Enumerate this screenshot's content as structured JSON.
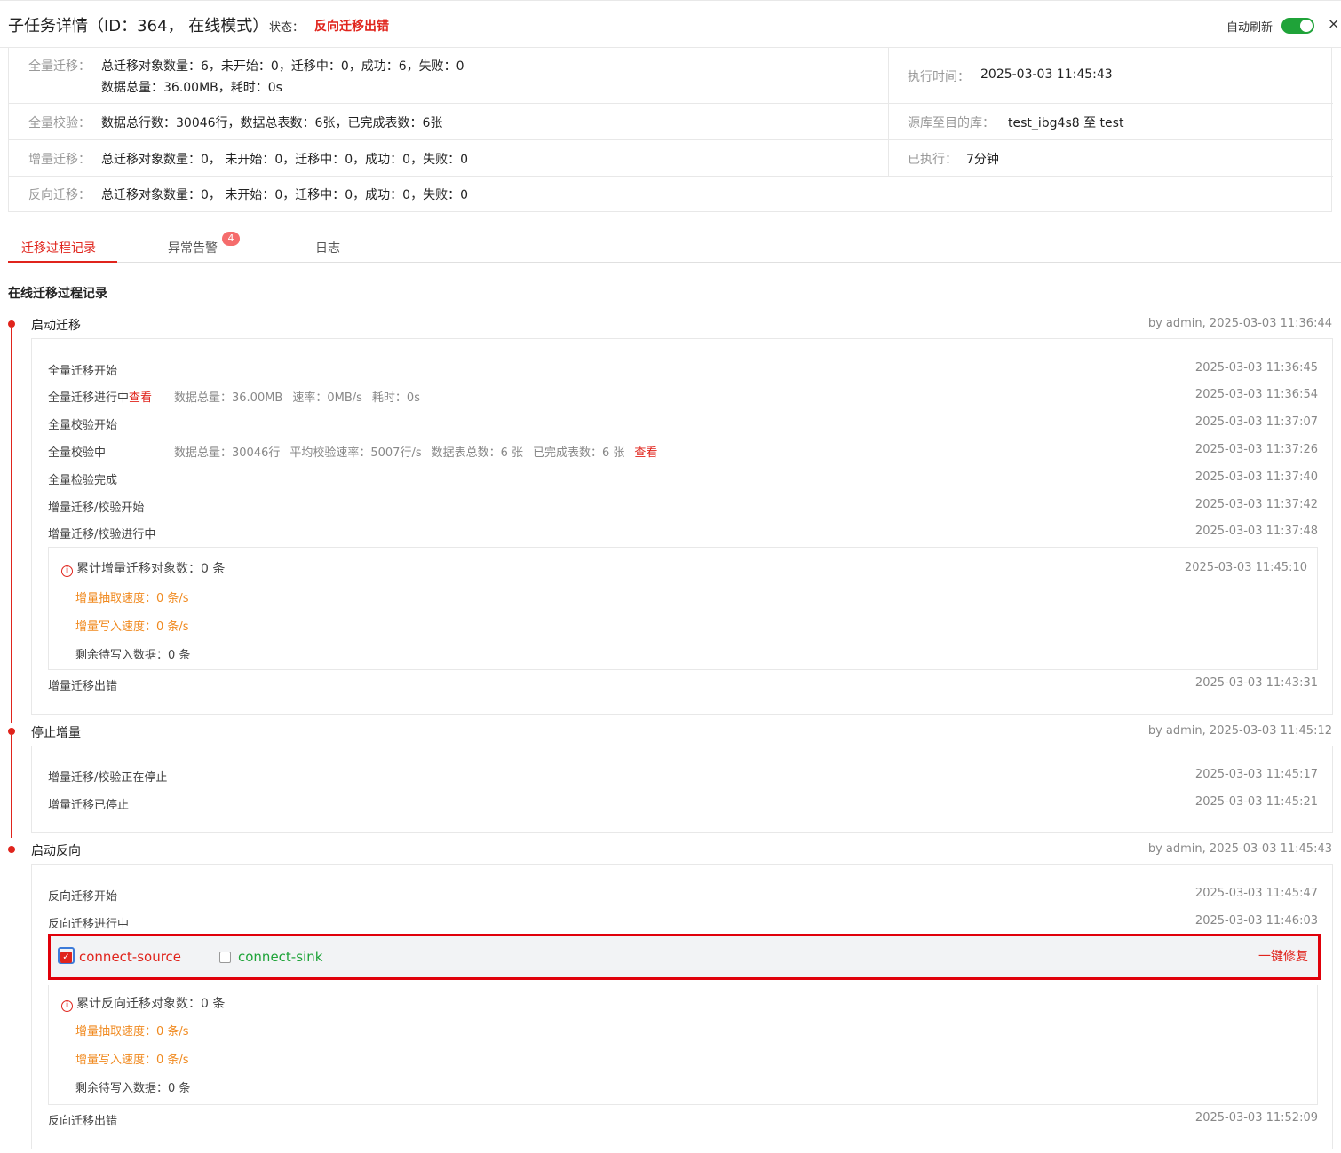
{
  "header": {
    "title": "子任务详情（ID：364， 在线模式）",
    "status_label": "状态：",
    "status_value": "反向迁移出错",
    "auto_refresh_label": "自动刷新",
    "close": "×"
  },
  "summary": {
    "full_migration_label": "全量迁移：",
    "full_migration_line1": "总迁移对象数量：6，未开始：0，迁移中：0，成功：6，失败：0",
    "full_migration_line2": "数据总量：36.00MB，耗时：0s",
    "exec_time_label": "执行时间：",
    "exec_time_value": "2025-03-03 11:45:43",
    "full_check_label": "全量校验：",
    "full_check_value": "数据总行数：30046行，数据总表数：6张，已完成表数：6张",
    "db_label": "源库至目的库：",
    "db_value": "test_ibg4s8 至 test",
    "incr_label": "增量迁移：",
    "incr_value": "总迁移对象数量：0， 未开始：0，迁移中：0，成功：0，失败：0",
    "elapsed_label": "已执行：",
    "elapsed_value": "7分钟",
    "reverse_label": "反向迁移：",
    "reverse_value": "总迁移对象数量：0， 未开始：0，迁移中：0，成功：0，失败：0"
  },
  "tabs": {
    "process": "迁移过程记录",
    "alerts": "异常告警",
    "alerts_badge": "4",
    "logs": "日志"
  },
  "section_title": "在线迁移过程记录",
  "stage1": {
    "title": "启动迁移",
    "by": "by admin, 2025-03-03 11:36:44",
    "items": [
      {
        "name": "全量迁移开始",
        "ts": "2025-03-03 11:36:45"
      },
      {
        "name": "全量迁移进行中",
        "link": "查看",
        "ts": "2025-03-03 11:36:54",
        "meta": [
          "数据总量：36.00MB",
          "速率：0MB/s",
          "耗时：0s"
        ]
      },
      {
        "name": "全量校验开始",
        "ts": "2025-03-03 11:37:07"
      },
      {
        "name": "全量校验中",
        "ts": "2025-03-03 11:37:26",
        "meta": [
          "数据总量：30046行",
          "平均校验速率：5007行/s",
          "数据表总数：6 张",
          "已完成表数：6 张"
        ],
        "link": "查看"
      },
      {
        "name": "全量检验完成",
        "ts": "2025-03-03 11:37:40"
      },
      {
        "name": "增量迁移/校验开始",
        "ts": "2025-03-03 11:37:42"
      },
      {
        "name": "增量迁移/校验进行中",
        "ts": "2025-03-03 11:37:48"
      },
      {
        "name": "增量迁移出错",
        "ts": "2025-03-03 11:43:31"
      }
    ],
    "inner": {
      "head": "累计增量迁移对象数：0 条",
      "ts": "2025-03-03 11:45:10",
      "extract": "增量抽取速度：0 条/s",
      "write": "增量写入速度：0 条/s",
      "remain": "剩余待写入数据：0 条"
    }
  },
  "stage2": {
    "title": "停止增量",
    "by": "by admin, 2025-03-03 11:45:12",
    "items": [
      {
        "name": "增量迁移/校验正在停止",
        "ts": "2025-03-03 11:45:17"
      },
      {
        "name": "增量迁移已停止",
        "ts": "2025-03-03 11:45:21"
      }
    ]
  },
  "stage3": {
    "title": "启动反向",
    "by": "by admin, 2025-03-03 11:45:43",
    "items": [
      {
        "name": "反向迁移开始",
        "ts": "2025-03-03 11:45:47"
      },
      {
        "name": "反向迁移进行中",
        "ts": "2025-03-03 11:46:03"
      },
      {
        "name": "反向迁移出错",
        "ts": "2025-03-03 11:52:09"
      }
    ],
    "connectors": {
      "source": "connect-source",
      "source_checked": true,
      "sink": "connect-sink",
      "sink_checked": false,
      "fix": "一键修复"
    },
    "inner": {
      "head": "累计反向迁移对象数：0 条",
      "extract": "增量抽取速度：0 条/s",
      "write": "增量写入速度：0 条/s",
      "remain": "剩余待写入数据：0 条"
    }
  },
  "colors": {
    "accent": "#e0241c",
    "toggle_on": "#1fa339",
    "warning": "#f0891e",
    "source_text": "#e0241c",
    "sink_text": "#1fa339",
    "highlight_border": "#e0000a"
  }
}
